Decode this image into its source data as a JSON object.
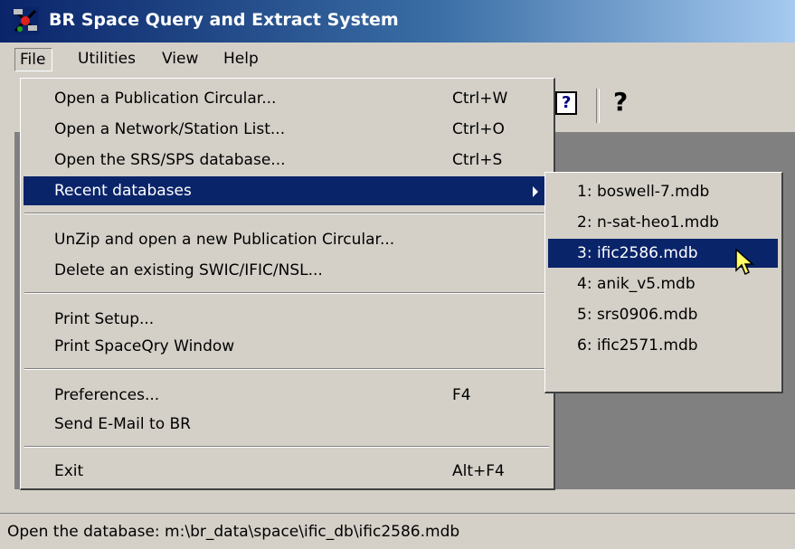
{
  "window": {
    "title": "BR Space Query and Extract System",
    "app_icon": "satellite-app-icon"
  },
  "menubar": {
    "file": "File",
    "utilities": "Utilities",
    "view": "View",
    "help": "Help"
  },
  "toolbar": {
    "help_topics_icon": "?",
    "about_icon": "?"
  },
  "file_menu": {
    "items": [
      {
        "label": "Open a Publication Circular...",
        "shortcut": "Ctrl+W"
      },
      {
        "label": "Open a Network/Station List...",
        "shortcut": "Ctrl+O"
      },
      {
        "label": "Open the SRS/SPS database...",
        "shortcut": "Ctrl+S"
      },
      {
        "label": "Recent databases",
        "shortcut": ""
      },
      {
        "label": "UnZip and open a new Publication Circular...",
        "shortcut": ""
      },
      {
        "label": "Delete an existing SWIC/IFIC/NSL...",
        "shortcut": ""
      },
      {
        "label": "Print Setup...",
        "shortcut": ""
      },
      {
        "label": "Print SpaceQry Window",
        "shortcut": ""
      },
      {
        "label": "Preferences...",
        "shortcut": "F4"
      },
      {
        "label": "Send E-Mail to BR",
        "shortcut": ""
      },
      {
        "label": "Exit",
        "shortcut": "Alt+F4"
      }
    ]
  },
  "recent_menu": {
    "items": [
      {
        "label": "1: boswell-7.mdb"
      },
      {
        "label": "2: n-sat-heo1.mdb"
      },
      {
        "label": "3: ific2586.mdb"
      },
      {
        "label": "4: anik_v5.mdb"
      },
      {
        "label": "5: srs0906.mdb"
      },
      {
        "label": "6: ific2571.mdb"
      }
    ]
  },
  "statusbar": {
    "text": "Open the database: m:\\br_data\\space\\ific_db\\ific2586.mdb"
  },
  "colors": {
    "highlight": "#0a246a",
    "face": "#d4d0c8",
    "workspace": "#808080"
  }
}
